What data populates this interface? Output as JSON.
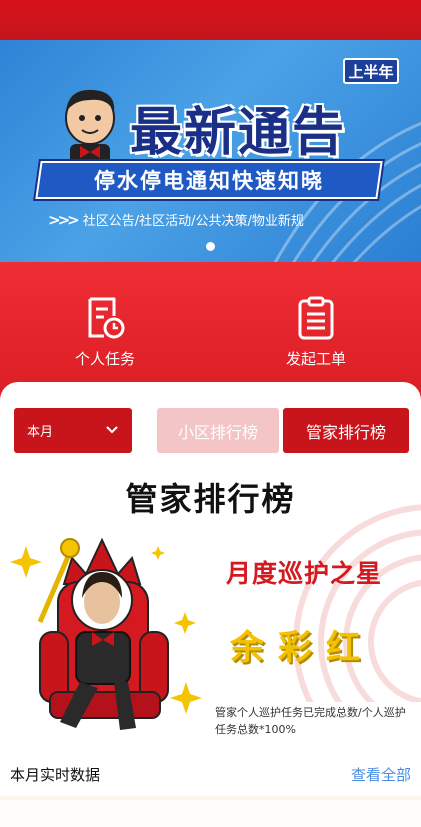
{
  "banner": {
    "badge": "上半年",
    "headline": "最新通告",
    "subheadline": "停水停电通知快速知晓",
    "topics": "社区公告/社区活动/公共决策/物业新规"
  },
  "quick_actions": [
    {
      "label": "个人任务",
      "icon": "calendar-clock-icon"
    },
    {
      "label": "发起工单",
      "icon": "clipboard-list-icon"
    }
  ],
  "filters": {
    "month": "本月",
    "tabs": [
      "小区排行榜",
      "管家排行榜"
    ],
    "active_tab": "管家排行榜"
  },
  "ranking": {
    "title": "管家排行榜",
    "star_title": "月度巡护之星",
    "star_name": "余彩红",
    "note": "管家个人巡护任务已完成总数/个人巡护任务总数*100%"
  },
  "realtime": {
    "label": "本月实时数据",
    "view_all": "查看全部"
  },
  "colors": {
    "brand_red": "#c8151c",
    "banner_blue": "#2f83d6",
    "link_blue": "#4a8de0",
    "gold": "#f2c200"
  }
}
